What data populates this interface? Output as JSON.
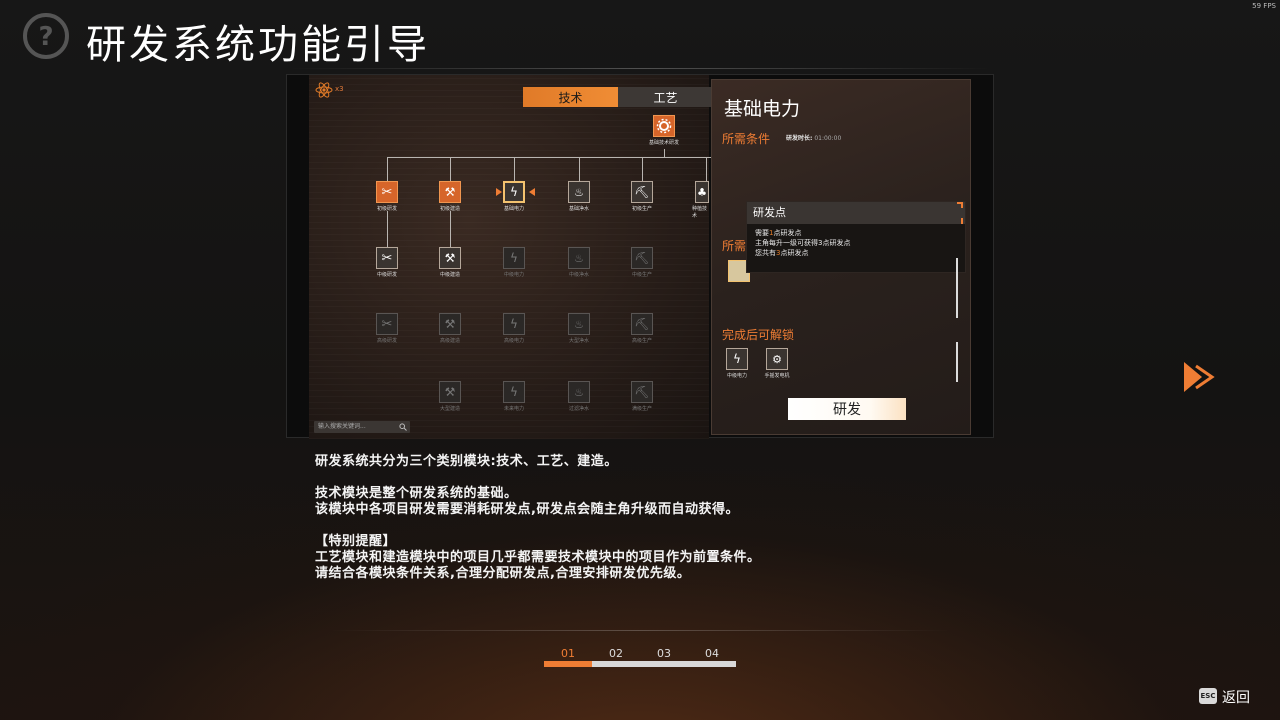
{
  "fps": "59 FPS",
  "page_title": "研发系统功能引导",
  "preview": {
    "atom_count": "x3",
    "tabs": [
      {
        "label": "技术",
        "active": true
      },
      {
        "label": "工艺",
        "active": false
      }
    ],
    "root_node": {
      "label": "基础技术研发",
      "icon": "gear-icon",
      "state": "lit"
    },
    "tree_nodes": [
      {
        "label": "初级研发",
        "icon": "wrench-icon",
        "state": "lit"
      },
      {
        "label": "初级建造",
        "icon": "hammer-icon",
        "state": "lit"
      },
      {
        "label": "基础电力",
        "icon": "lightning-icon",
        "state": "selected"
      },
      {
        "label": "基础净水",
        "icon": "water-icon",
        "state": "mid"
      },
      {
        "label": "初级生产",
        "icon": "pickaxe-icon",
        "state": "mid"
      },
      {
        "label": "种植技术",
        "icon": "plant-icon",
        "state": "mid"
      },
      {
        "label": "中级研发",
        "icon": "wrench-icon",
        "state": "mid"
      },
      {
        "label": "中级建造",
        "icon": "hammer-icon",
        "state": "mid"
      },
      {
        "label": "中级电力",
        "icon": "lightning-icon",
        "state": "dim"
      },
      {
        "label": "中级净水",
        "icon": "water-icon",
        "state": "dim"
      },
      {
        "label": "中级生产",
        "icon": "pickaxe-icon",
        "state": "dim"
      },
      {
        "label": "高级研发",
        "icon": "wrench-icon",
        "state": "dim"
      },
      {
        "label": "高级建造",
        "icon": "hammer-icon",
        "state": "dim"
      },
      {
        "label": "高级电力",
        "icon": "lightning-icon",
        "state": "dim"
      },
      {
        "label": "大型净水",
        "icon": "water-icon",
        "state": "dim"
      },
      {
        "label": "高级生产",
        "icon": "pickaxe-icon",
        "state": "dim"
      },
      {
        "label": "大型建造",
        "icon": "hammer-icon",
        "state": "dim"
      },
      {
        "label": "未来电力",
        "icon": "lightning-icon",
        "state": "dim"
      },
      {
        "label": "过滤净水",
        "icon": "water-icon",
        "state": "dim"
      },
      {
        "label": "满级生产",
        "icon": "pickaxe-icon",
        "state": "dim"
      }
    ],
    "search_placeholder": "输入搜索关键词...",
    "detail": {
      "title": "基础电力",
      "requirements_label": "所需条件",
      "duration_label": "研发时长:",
      "duration_value": "01:00:00",
      "requirements_label_2": "所需",
      "tooltip": {
        "title": "研发点",
        "line1_pre": "需要",
        "line1_num": "1",
        "line1_post": "点研发点",
        "line2": "主角每升一级可获得3点研发点",
        "line3_pre": "您共有",
        "line3_num": "3",
        "line3_post": "点研发点"
      },
      "unlock_label": "完成后可解锁",
      "unlocks": [
        {
          "label": "中级电力",
          "icon": "lightning-icon"
        },
        {
          "label": "手摇发电机",
          "icon": "generator-icon"
        }
      ],
      "research_button": "研发"
    }
  },
  "description": {
    "line1": "研发系统共分为三个类别模块:技术、工艺、建造。",
    "line2": "技术模块是整个研发系统的基础。",
    "line3": "该模块中各项目研发需要消耗研发点,研发点会随主角升级而自动获得。",
    "line4": "【特别提醒】",
    "line5": "工艺模块和建造模块中的项目几乎都需要技术模块中的项目作为前置条件。",
    "line6": "请结合各模块条件关系,合理分配研发点,合理安排研发优先级。"
  },
  "pager": {
    "pages": [
      "01",
      "02",
      "03",
      "04"
    ],
    "active_index": 0
  },
  "footer": {
    "esc_key": "ESC",
    "back_label": "返回"
  },
  "colors": {
    "accent": "#ef7d34",
    "background": "#161616",
    "text": "#f4f4f4"
  }
}
